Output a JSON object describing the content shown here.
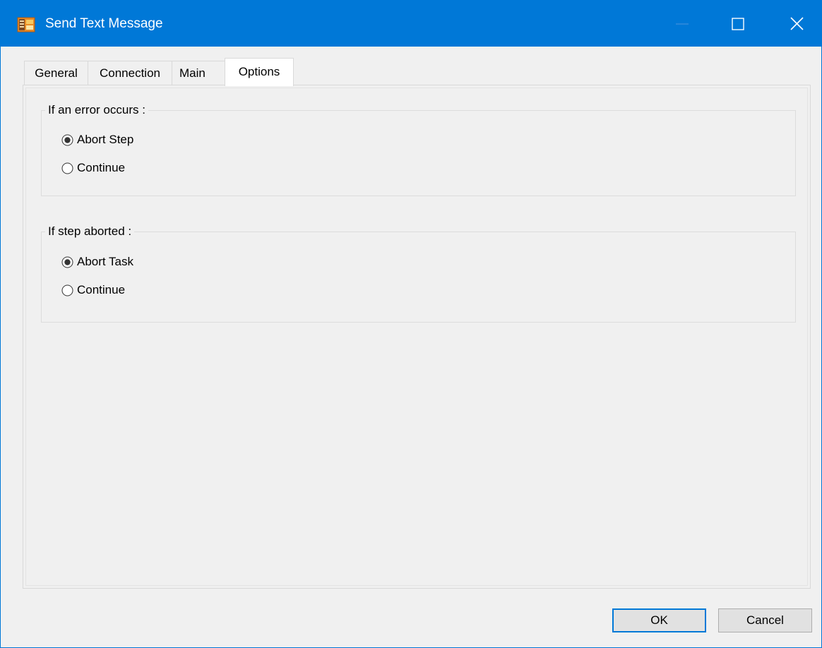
{
  "window": {
    "title": "Send Text Message",
    "accent_color": "#0078d7"
  },
  "tabs": [
    {
      "label": "General",
      "selected": false
    },
    {
      "label": "Connection",
      "selected": false
    },
    {
      "label": "Main",
      "selected": false
    },
    {
      "label": "Options",
      "selected": true
    }
  ],
  "error_group": {
    "legend": "If an error occurs :",
    "options": [
      {
        "label": "Abort Step",
        "checked": true
      },
      {
        "label": "Continue",
        "checked": false
      }
    ]
  },
  "aborted_group": {
    "legend": "If step aborted :",
    "options": [
      {
        "label": "Abort Task",
        "checked": true
      },
      {
        "label": "Continue",
        "checked": false
      }
    ]
  },
  "buttons": {
    "ok_label": "OK",
    "cancel_label": "Cancel"
  },
  "icons": [
    "app-icon",
    "minimize-icon",
    "maximize-icon",
    "close-icon",
    "radio-icon"
  ]
}
